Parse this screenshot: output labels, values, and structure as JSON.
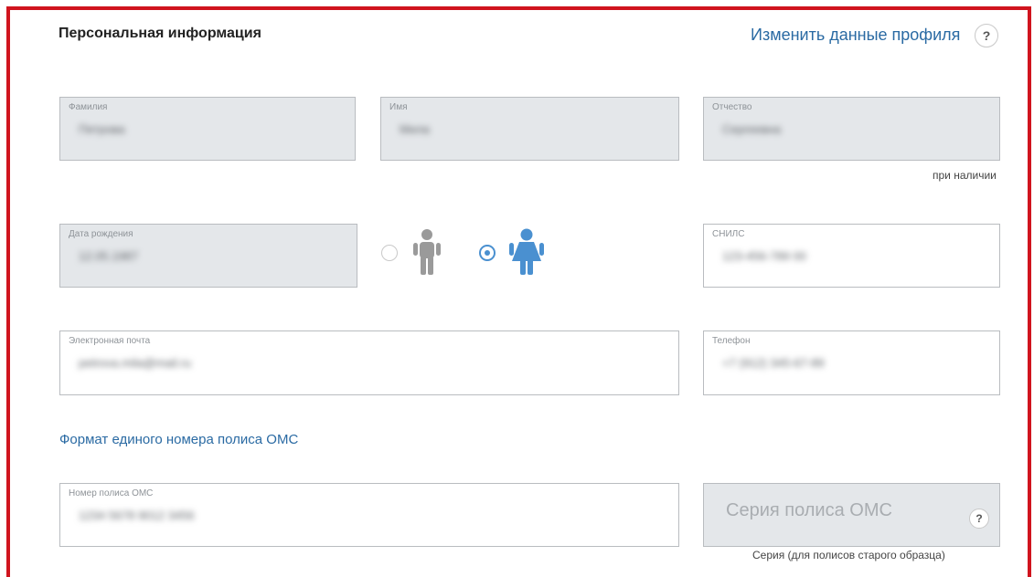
{
  "section": {
    "title": "Персональная информация",
    "edit_link": "Изменить данные профиля",
    "help_symbol": "?"
  },
  "fields": {
    "lastname": {
      "label": "Фамилия",
      "value": "Петрова"
    },
    "firstname": {
      "label": "Имя",
      "value": "Мила"
    },
    "patronymic": {
      "label": "Отчество",
      "value": "Сергеевна",
      "hint": "при наличии"
    },
    "birthdate": {
      "label": "Дата рождения",
      "value": "12.05.1987"
    },
    "snils": {
      "label": "СНИЛС",
      "value": "123-456-789 00"
    },
    "email": {
      "label": "Электронная почта",
      "value": "petrova.mila@mail.ru"
    },
    "phone": {
      "label": "Телефон",
      "value": "+7 (912) 345-67-89"
    },
    "policy_number": {
      "label": "Номер полиса ОМС",
      "value": "1234 5678 9012 3456"
    },
    "policy_series": {
      "placeholder": "Серия полиса ОМС",
      "hint": "Серия (для полисов старого образца)"
    }
  },
  "gender": {
    "options": [
      "male",
      "female"
    ],
    "selected": "female",
    "colors": {
      "inactive": "#9a9a9a",
      "active": "#4a90d0"
    }
  },
  "policy_format_link": "Формат единого номера полиса ОМС",
  "colors": {
    "accent": "#2a6aa3",
    "frame": "#d0141e"
  }
}
